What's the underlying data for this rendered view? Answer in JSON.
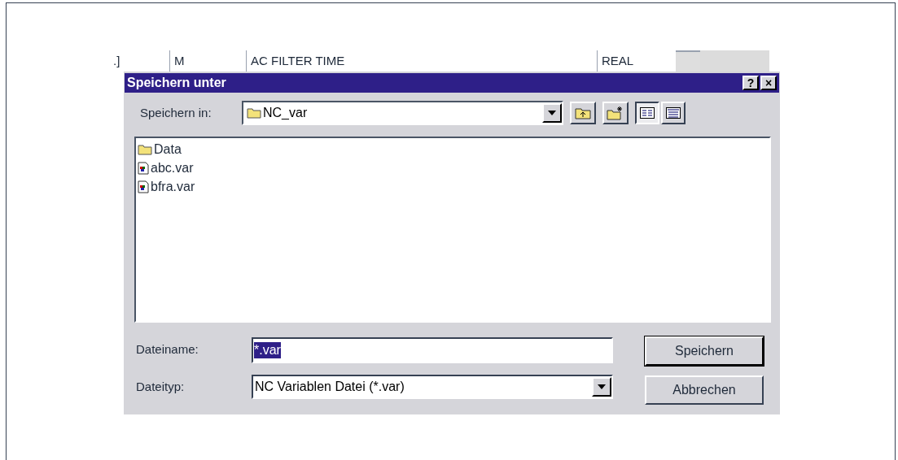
{
  "background_row": {
    "cells": [
      ".]",
      "M",
      "AC FILTER TIME",
      "REAL"
    ]
  },
  "dialog": {
    "title": "Speichern unter",
    "title_buttons": [
      "?",
      "×"
    ],
    "save_in": {
      "label": "Speichern in:",
      "value": "NC_var"
    },
    "files": [
      {
        "kind": "folder",
        "name": "Data"
      },
      {
        "kind": "file",
        "name": "abc.var"
      },
      {
        "kind": "file",
        "name": "bfra.var"
      }
    ],
    "view_buttons": [
      {
        "kind": "list",
        "selected": true
      },
      {
        "kind": "details",
        "selected": false
      }
    ],
    "filename": {
      "label": "Dateiname:",
      "value": "*.var"
    },
    "filetype": {
      "label": "Dateityp:",
      "value": "NC Variablen Datei (*.var)"
    },
    "buttons": [
      "Speichern",
      "Abbrechen"
    ]
  }
}
